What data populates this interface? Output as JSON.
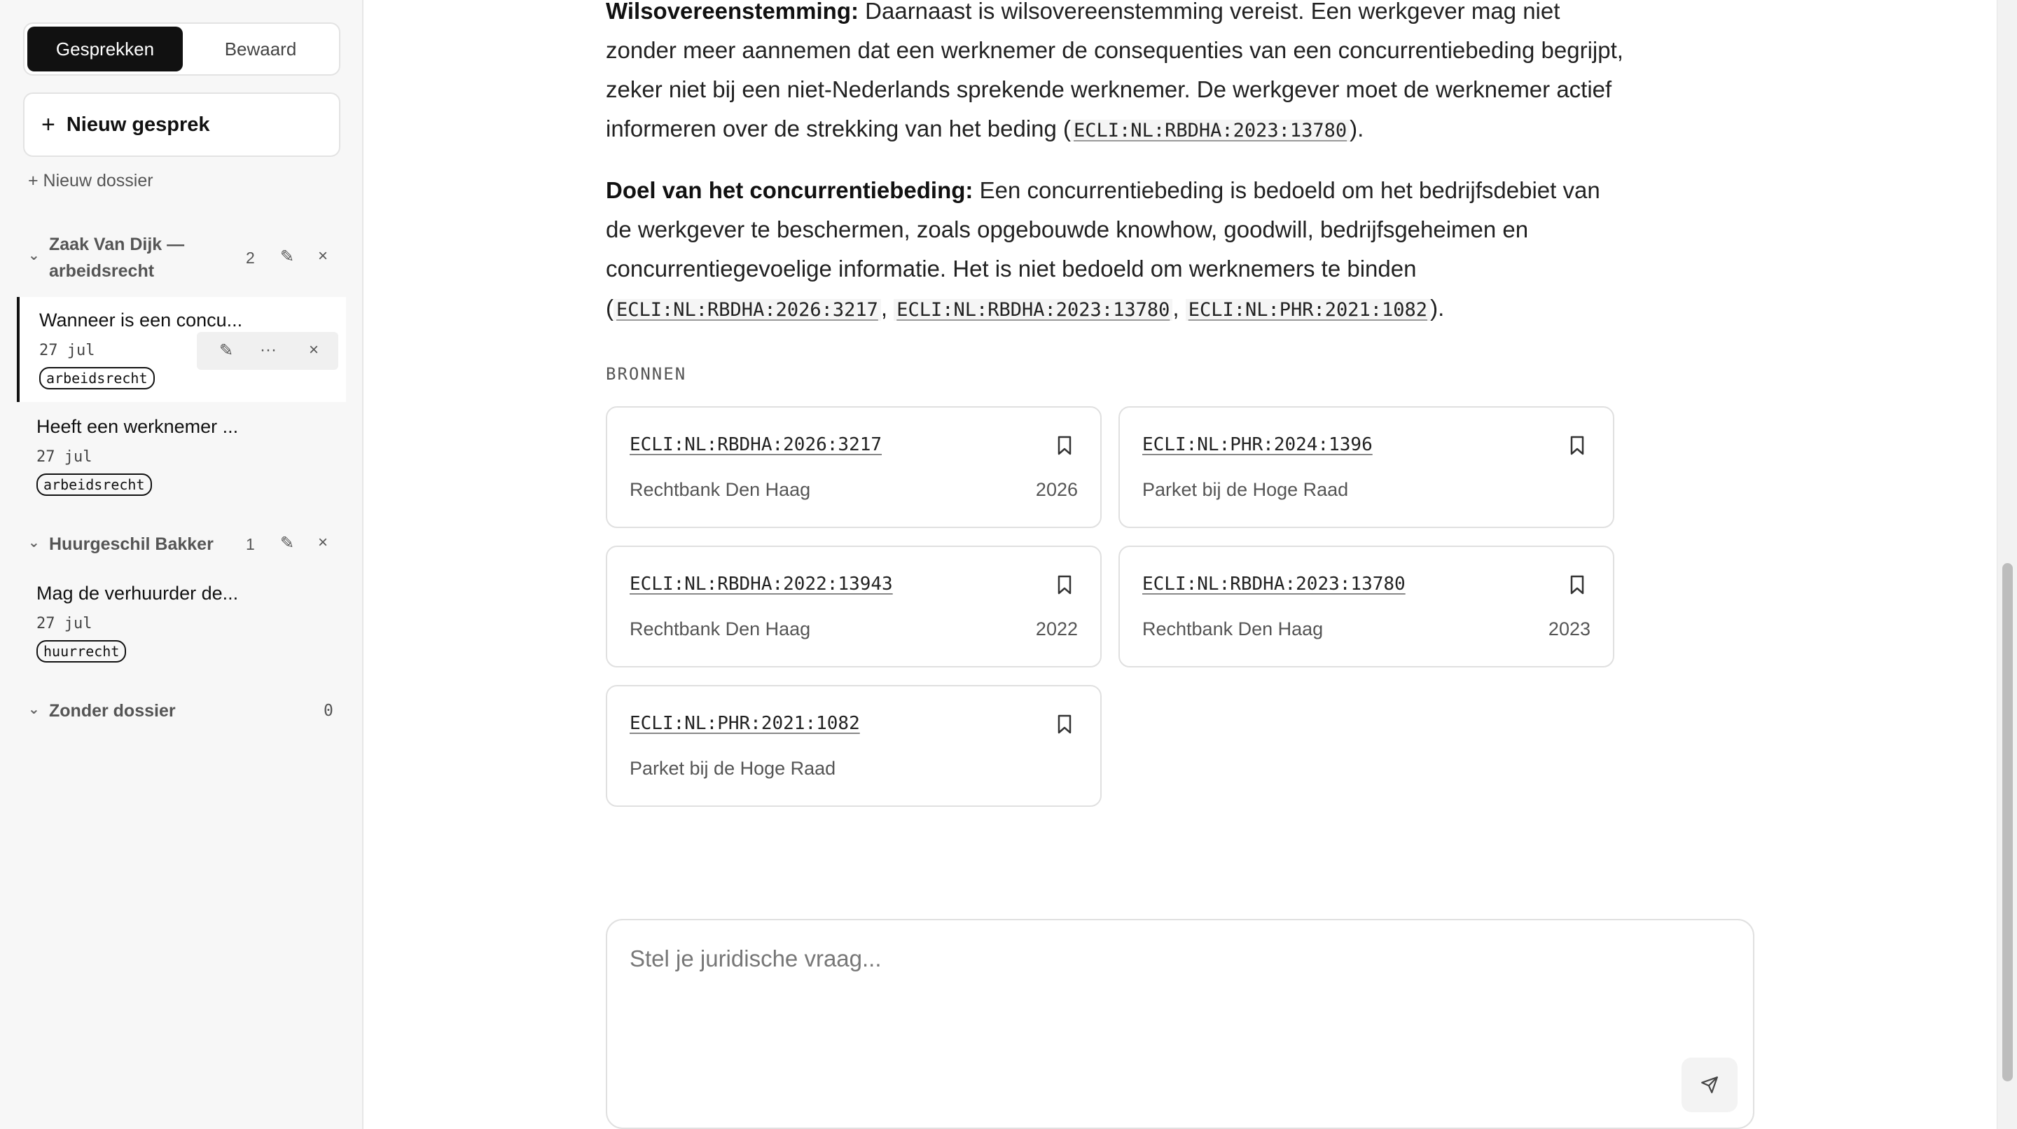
{
  "sidebar": {
    "tabs": [
      {
        "label": "Gesprekken",
        "active": true
      },
      {
        "label": "Bewaard",
        "active": false
      }
    ],
    "new_chat_label": "Nieuw gesprek",
    "new_chat_icon": "plus-icon",
    "new_dossier_label": "+ Nieuw dossier",
    "groups": [
      {
        "title": "Zaak Van Dijk — arbeidsrecht",
        "count": "2",
        "conversations": [
          {
            "title": "Wanneer is een concu...",
            "date": "27 jul",
            "tag": "arbeidsrecht",
            "active": true
          },
          {
            "title": "Heeft een werknemer ...",
            "date": "27 jul",
            "tag": "arbeidsrecht",
            "active": false
          }
        ]
      },
      {
        "title": "Huurgeschil Bakker",
        "count": "1",
        "conversations": [
          {
            "title": "Mag de verhuurder de...",
            "date": "27 jul",
            "tag": "huurrecht",
            "active": false
          }
        ]
      },
      {
        "title": "Zonder dossier",
        "count": "0",
        "conversations": []
      }
    ],
    "icons": {
      "edit": "✎",
      "close": "×",
      "more": "···",
      "chevron": "⌄"
    }
  },
  "main": {
    "paragraphs": [
      {
        "heading": "Wilsovereenstemming:",
        "text": " Daarnaast is wilsovereenstemming vereist. Een werkgever mag niet zonder meer aannemen dat een werknemer de consequenties van een concurrentiebeding begrijpt, zeker niet bij een niet-Nederlands sprekende werknemer. De werkgever moet de werknemer actief informeren over de strekking van het beding (",
        "citations": [
          "ECLI:NL:RBDHA:2023:13780"
        ],
        "end": ")."
      },
      {
        "heading": "Doel van het concurrentiebeding:",
        "text": " Een concurrentiebeding is bedoeld om het bedrijfsdebiet van de werkgever te beschermen, zoals opgebouwde knowhow, goodwill, bedrijfsgeheimen en concurrentiegevoelige informatie. Het is niet bedoeld om werknemers te binden (",
        "citations": [
          "ECLI:NL:RBDHA:2026:3217",
          "ECLI:NL:RBDHA:2023:13780",
          "ECLI:NL:PHR:2021:1082"
        ],
        "end": ")."
      }
    ],
    "sources_heading": "BRONNEN",
    "sources": [
      {
        "ecli": "ECLI:NL:RBDHA:2026:3217",
        "court": "Rechtbank Den Haag",
        "year": "2026"
      },
      {
        "ecli": "ECLI:NL:PHR:2024:1396",
        "court": "Parket bij de Hoge Raad",
        "year": ""
      },
      {
        "ecli": "ECLI:NL:RBDHA:2022:13943",
        "court": "Rechtbank Den Haag",
        "year": "2022"
      },
      {
        "ecli": "ECLI:NL:RBDHA:2023:13780",
        "court": "Rechtbank Den Haag",
        "year": "2023"
      },
      {
        "ecli": "ECLI:NL:PHR:2021:1082",
        "court": "Parket bij de Hoge Raad",
        "year": ""
      }
    ],
    "composer": {
      "placeholder": "Stel je juridische vraag...",
      "value": "",
      "send_icon": "send-icon"
    }
  }
}
